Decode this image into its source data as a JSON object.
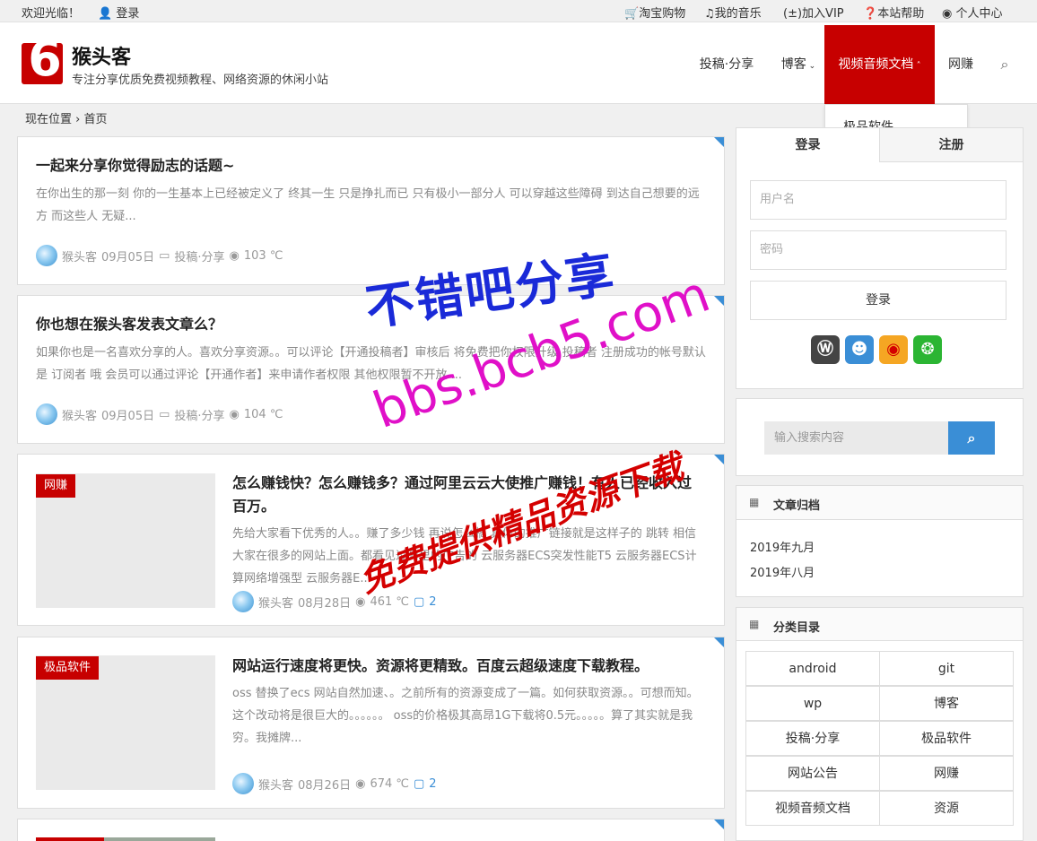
{
  "topbar": {
    "welcome": "欢迎光临！",
    "login": "登录",
    "links": [
      "淘宝购物",
      "我的音乐",
      "加入VIP",
      "本站帮助",
      "个人中心"
    ]
  },
  "site": {
    "logo_char": "6",
    "name": "猴头客",
    "desc": "专注分享优质免费视频教程、网络资源的休闲小站"
  },
  "nav": {
    "items": [
      "投稿·分享",
      "博客",
      "视频音频文档",
      "网赚"
    ],
    "dropdown_item": "极品软件"
  },
  "breadcrumb": {
    "label": "现在位置",
    "sep": "›",
    "current": "首页"
  },
  "posts": [
    {
      "title": "一起来分享你觉得励志的话题~",
      "excerpt": "在你出生的那一刻 你的一生基本上已经被定义了 终其一生 只是挣扎而已 只有极小一部分人 可以穿越这些障碍 到达自己想要的远方 而这些人 无疑...",
      "author": "猴头客",
      "date": "09月05日",
      "category": "投稿·分享",
      "views": "103 ℃"
    },
    {
      "title": "你也想在猴头客发表文章么？",
      "excerpt": "如果你也是一名喜欢分享的人。喜欢分享资源。。可以评论【开通投稿者】审核后 将免费把你权限升级 投稿者 注册成功的帐号默认是 订阅者 哦 会员可以通过评论【开通作者】来申请作者权限 其他权限暂不开放 ...",
      "author": "猴头客",
      "date": "09月05日",
      "category": "投稿·分享",
      "views": "104 ℃"
    },
    {
      "badge": "网赚",
      "title": "怎么赚钱快？怎么赚钱多？通过阿里云云大使推广赚钱！有人已经收入过百万。",
      "excerpt": "先给大家看下优秀的人。。赚了多少钱 再说怎么搞 具体的推广链接就是这样子的 跳转 相信大家在很多的网站上面。都看见过阿里的广告的 云服务器ECS突发性能T5 云服务器ECS计算网络增强型 云服务器E...",
      "author": "猴头客",
      "date": "08月28日",
      "views": "461 ℃",
      "comments": "2"
    },
    {
      "badge": "极品软件",
      "title": "网站运行速度将更快。资源将更精致。百度云超级速度下载教程。",
      "excerpt": "oss 替换了ecs 网站自然加速、。之前所有的资源变成了一篇。如何获取资源。。可想而知。这个改动将是很巨大的。。。。。。 oss的价格极其高昂1G下载将0.5元。。。。。算了其实就是我穷。我摊牌...",
      "author": "猴头客",
      "date": "08月26日",
      "views": "674 ℃",
      "comments": "2"
    }
  ],
  "login_widget": {
    "tab_login": "登录",
    "tab_register": "注册",
    "username_placeholder": "用户名",
    "password_placeholder": "密码",
    "button": "登录"
  },
  "search_widget": {
    "placeholder": "输入搜索内容"
  },
  "archive_widget": {
    "title": "文章归档",
    "items": [
      "2019年九月",
      "2019年八月"
    ]
  },
  "category_widget": {
    "title": "分类目录",
    "items": [
      "android",
      "git",
      "wp",
      "博客",
      "投稿·分享",
      "极品软件",
      "网站公告",
      "网赚",
      "视频音频文档",
      "资源"
    ]
  },
  "watermark": {
    "line1": "不错吧分享",
    "line2": "bbs.bcb5.com",
    "line3": "免费提供精品资源下载"
  },
  "colors": {
    "brand_red": "#c70000",
    "accent_blue": "#3a8ed6",
    "watermark_blue": "#1a2ad8",
    "watermark_magenta": "#e010c8",
    "watermark_red": "#d40000"
  }
}
